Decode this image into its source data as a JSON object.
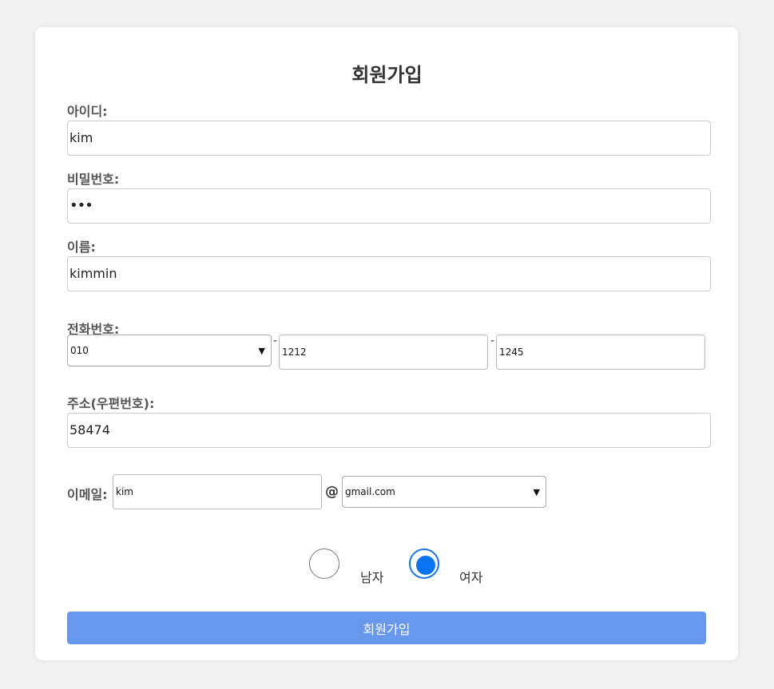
{
  "form": {
    "title": "회원가입",
    "id_label": "아이디:",
    "id_value": "kim",
    "password_label": "비밀번호:",
    "password_masked": "•••",
    "name_label": "이름:",
    "name_value": "kimmin",
    "phone_label": "전화번호:",
    "phone_prefix": "010",
    "phone_middle": "1212",
    "phone_last": "1245",
    "phone_separator": "-",
    "address_label": "주소(우편번호):",
    "address_value": "58474",
    "email_label": "이메일:",
    "email_user": "kim",
    "email_at": "@",
    "email_domain": "gmail.com",
    "gender_male": "남자",
    "gender_female": "여자",
    "gender_selected": "여자",
    "submit_label": "회원가입"
  },
  "colors": {
    "background": "#f2f2f2",
    "card": "#ffffff",
    "submit_button": "#6898ec",
    "radio_accent": "#0a74f0"
  }
}
